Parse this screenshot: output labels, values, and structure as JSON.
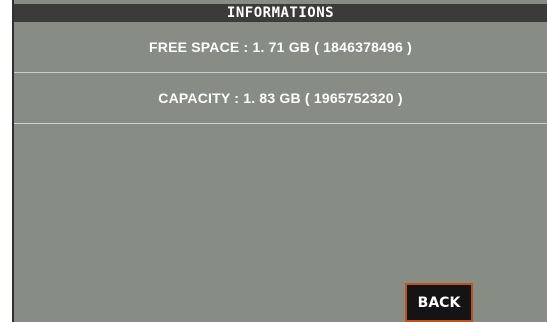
{
  "header": {
    "title": "INFORMATIONS"
  },
  "info": {
    "free_space": "FREE SPACE : 1. 71 GB ( 1846378496 )",
    "capacity": "CAPACITY : 1. 83 GB ( 1965752320 )"
  },
  "buttons": {
    "back_label": "BACK"
  },
  "colors": {
    "screen_bg": "#878c84",
    "title_bg": "#3b3b3b",
    "button_bg": "#141414",
    "button_border": "#c0531b"
  }
}
